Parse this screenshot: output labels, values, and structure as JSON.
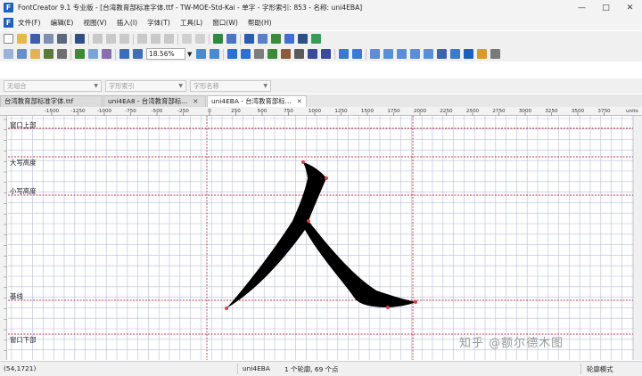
{
  "window": {
    "title": "FontCreator 9.1 专业版  - [台湾教育部标准字体.ttf - TW-MOE-Std-Kai - 单字 - 字形索引: 853 - 名称: uni4EBA]",
    "app_icon": "F",
    "controls": [
      "minimize-icon",
      "maximize-icon",
      "close-icon"
    ]
  },
  "menu": {
    "icon": "F",
    "items": [
      "文件(F)",
      "编辑(E)",
      "视图(V)",
      "插入(I)",
      "字体(T)",
      "工具(L)",
      "窗口(W)",
      "帮助(H)"
    ]
  },
  "toolbar": {
    "zoom_value": "18.56%"
  },
  "selectors": {
    "combo1_placeholder": "无组合",
    "combo2_placeholder": "字形索引",
    "combo3_placeholder": "字形名称"
  },
  "tabs": [
    {
      "label": "台湾教育部标准字体.ttf",
      "active": false
    },
    {
      "label": "uni4EA8 - 台湾教育部标...",
      "active": false
    },
    {
      "label": "uni4EBA - 台湾教育部标...",
      "active": true
    }
  ],
  "ruler": {
    "ticks": [
      "-1500",
      "-1250",
      "-1000",
      "-750",
      "-500",
      "-250",
      "0",
      "250",
      "500",
      "750",
      "1000",
      "1250",
      "1500",
      "1750",
      "2000",
      "2250",
      "2500",
      "2750",
      "3000",
      "3250",
      "3500",
      "3750"
    ],
    "units_label": "units"
  },
  "guides": {
    "top": "窗口上部",
    "ascender": "大写高度",
    "x_height": "小写高度",
    "baseline": "基线",
    "bottom": "窗口下部"
  },
  "glyph": {
    "name": "uni4EBA",
    "character": "人",
    "fill": "#000000",
    "point_color": "#e04040"
  },
  "watermark": "知乎 @额尔德木图",
  "status": {
    "coords": "(54,1721)",
    "glyph_name": "uni4EBA",
    "contour_info": "1 个轮廓, 69 个点",
    "mode": "轮廓模式"
  },
  "colors": {
    "grid": "#b9bddb",
    "guide_line": "#c0384a",
    "accent": "#1f5fbf"
  }
}
